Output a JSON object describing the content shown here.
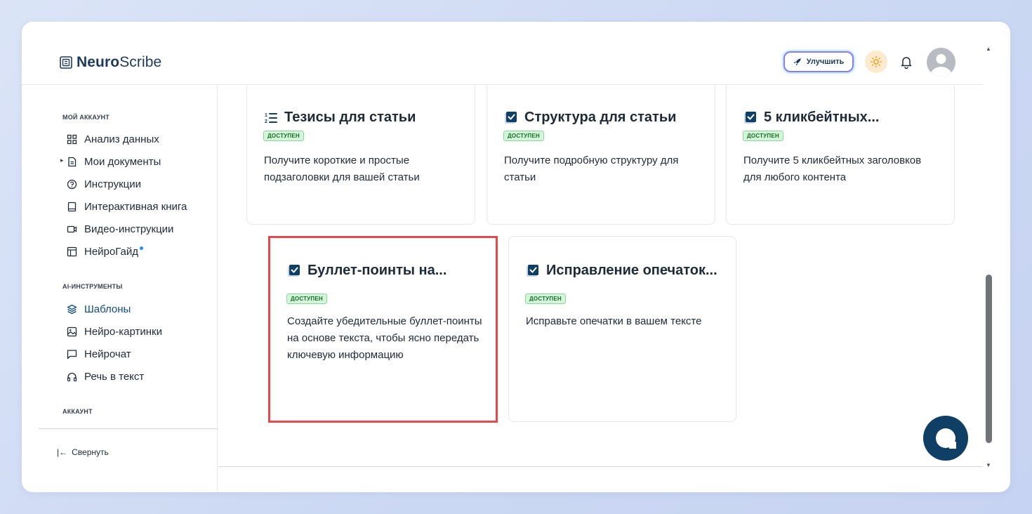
{
  "app": {
    "logo_bold": "Neuro",
    "logo_rest": "Scribe"
  },
  "header": {
    "upgrade_label": "Улучшить",
    "icons": [
      "rocket-icon",
      "sun-icon",
      "bell-icon",
      "avatar"
    ]
  },
  "sidebar": {
    "section_account": "МОЙ АККАУНТ",
    "account_items": [
      {
        "label": "Анализ данных",
        "icon": "grid-icon"
      },
      {
        "label": "Мои документы",
        "icon": "document-icon"
      },
      {
        "label": "Инструкции",
        "icon": "help-circle-icon"
      },
      {
        "label": "Интерактивная книга",
        "icon": "book-icon"
      },
      {
        "label": "Видео-инструкции",
        "icon": "video-icon"
      },
      {
        "label": "НейроГайд",
        "icon": "layout-icon"
      }
    ],
    "section_ai": "AI-ИНСТРУМЕНТЫ",
    "ai_items": [
      {
        "label": "Шаблоны",
        "icon": "layers-icon",
        "active": true
      },
      {
        "label": "Нейро-картинки",
        "icon": "image-icon"
      },
      {
        "label": "Нейрочат",
        "icon": "chat-icon"
      },
      {
        "label": "Речь в текст",
        "icon": "headphones-icon"
      }
    ],
    "section_settings": "АККАУНТ",
    "collapse_label": "Свернуть"
  },
  "cards": [
    {
      "title": "Тезисы для статьи",
      "badge": "ДОСТУПЕН",
      "desc": "Получите короткие и простые подзаголовки для вашей статьи",
      "icon": "numbered-list-icon"
    },
    {
      "title": "Структура для статьи",
      "badge": "ДОСТУПЕН",
      "desc": "Получите подробную структуру для статьи",
      "icon": "checkbox-icon"
    },
    {
      "title": "5 кликбейтных...",
      "badge": "ДОСТУПЕН",
      "desc": "Получите 5 кликбейтных заголовков для любого контента",
      "icon": "checkbox-icon"
    },
    {
      "title": "Буллет-поинты на...",
      "badge": "ДОСТУПЕН",
      "desc": "Создайте убедительные буллет-поинты на основе текста, чтобы ясно передать ключевую информацию",
      "icon": "checkbox-icon",
      "selected": true
    },
    {
      "title": "Исправление опечаток...",
      "badge": "ДОСТУПЕН",
      "desc": "Исправьте опечатки в вашем тексте",
      "icon": "checkbox-icon"
    }
  ],
  "colors": {
    "primary": "#0f3f64",
    "badge_bg": "#d3f5d8",
    "selection": "#e5484d"
  }
}
